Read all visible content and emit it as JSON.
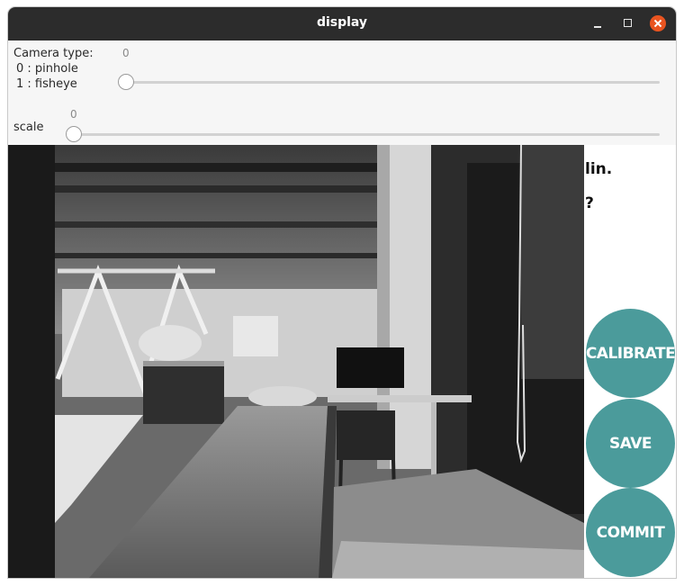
{
  "window": {
    "title": "display"
  },
  "controls": {
    "camera_type": {
      "label_line1": "Camera type:",
      "label_line2": "0 : pinhole",
      "label_line3": "1 : fisheye",
      "value": "0"
    },
    "scale": {
      "label": "scale",
      "value": "0"
    }
  },
  "overlay": {
    "line1": "lin.",
    "line2": "?"
  },
  "buttons": {
    "calibrate": "CALIBRATE",
    "save": "SAVE",
    "commit": "COMMIT"
  },
  "colors": {
    "titlebar": "#2c2c2c",
    "close": "#e95420",
    "button": "#4b9b9b"
  },
  "icons": [
    "minimize-icon",
    "maximize-icon",
    "close-icon"
  ]
}
